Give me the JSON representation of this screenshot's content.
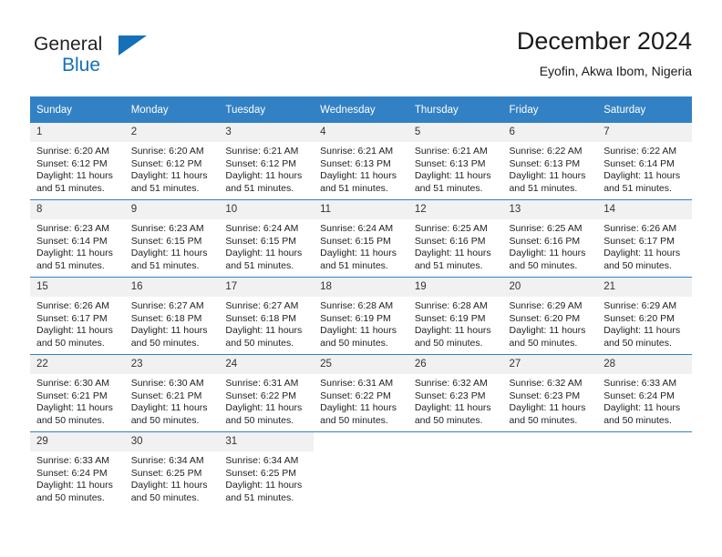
{
  "brand": {
    "name_part1": "General",
    "name_part2": "Blue",
    "accent_color": "#1470b8",
    "flag_icon": "blue-triangle-flag-icon"
  },
  "header": {
    "title": "December 2024",
    "subtitle": "Eyofin, Akwa Ibom, Nigeria"
  },
  "calendar": {
    "header_bg": "#3281c4",
    "daynum_bg": "#f1f1f1",
    "weekdays": [
      "Sunday",
      "Monday",
      "Tuesday",
      "Wednesday",
      "Thursday",
      "Friday",
      "Saturday"
    ],
    "weeks": [
      [
        {
          "day": "1",
          "sunrise": "Sunrise: 6:20 AM",
          "sunset": "Sunset: 6:12 PM",
          "daylight_1": "Daylight: 11 hours",
          "daylight_2": "and 51 minutes."
        },
        {
          "day": "2",
          "sunrise": "Sunrise: 6:20 AM",
          "sunset": "Sunset: 6:12 PM",
          "daylight_1": "Daylight: 11 hours",
          "daylight_2": "and 51 minutes."
        },
        {
          "day": "3",
          "sunrise": "Sunrise: 6:21 AM",
          "sunset": "Sunset: 6:12 PM",
          "daylight_1": "Daylight: 11 hours",
          "daylight_2": "and 51 minutes."
        },
        {
          "day": "4",
          "sunrise": "Sunrise: 6:21 AM",
          "sunset": "Sunset: 6:13 PM",
          "daylight_1": "Daylight: 11 hours",
          "daylight_2": "and 51 minutes."
        },
        {
          "day": "5",
          "sunrise": "Sunrise: 6:21 AM",
          "sunset": "Sunset: 6:13 PM",
          "daylight_1": "Daylight: 11 hours",
          "daylight_2": "and 51 minutes."
        },
        {
          "day": "6",
          "sunrise": "Sunrise: 6:22 AM",
          "sunset": "Sunset: 6:13 PM",
          "daylight_1": "Daylight: 11 hours",
          "daylight_2": "and 51 minutes."
        },
        {
          "day": "7",
          "sunrise": "Sunrise: 6:22 AM",
          "sunset": "Sunset: 6:14 PM",
          "daylight_1": "Daylight: 11 hours",
          "daylight_2": "and 51 minutes."
        }
      ],
      [
        {
          "day": "8",
          "sunrise": "Sunrise: 6:23 AM",
          "sunset": "Sunset: 6:14 PM",
          "daylight_1": "Daylight: 11 hours",
          "daylight_2": "and 51 minutes."
        },
        {
          "day": "9",
          "sunrise": "Sunrise: 6:23 AM",
          "sunset": "Sunset: 6:15 PM",
          "daylight_1": "Daylight: 11 hours",
          "daylight_2": "and 51 minutes."
        },
        {
          "day": "10",
          "sunrise": "Sunrise: 6:24 AM",
          "sunset": "Sunset: 6:15 PM",
          "daylight_1": "Daylight: 11 hours",
          "daylight_2": "and 51 minutes."
        },
        {
          "day": "11",
          "sunrise": "Sunrise: 6:24 AM",
          "sunset": "Sunset: 6:15 PM",
          "daylight_1": "Daylight: 11 hours",
          "daylight_2": "and 51 minutes."
        },
        {
          "day": "12",
          "sunrise": "Sunrise: 6:25 AM",
          "sunset": "Sunset: 6:16 PM",
          "daylight_1": "Daylight: 11 hours",
          "daylight_2": "and 51 minutes."
        },
        {
          "day": "13",
          "sunrise": "Sunrise: 6:25 AM",
          "sunset": "Sunset: 6:16 PM",
          "daylight_1": "Daylight: 11 hours",
          "daylight_2": "and 50 minutes."
        },
        {
          "day": "14",
          "sunrise": "Sunrise: 6:26 AM",
          "sunset": "Sunset: 6:17 PM",
          "daylight_1": "Daylight: 11 hours",
          "daylight_2": "and 50 minutes."
        }
      ],
      [
        {
          "day": "15",
          "sunrise": "Sunrise: 6:26 AM",
          "sunset": "Sunset: 6:17 PM",
          "daylight_1": "Daylight: 11 hours",
          "daylight_2": "and 50 minutes."
        },
        {
          "day": "16",
          "sunrise": "Sunrise: 6:27 AM",
          "sunset": "Sunset: 6:18 PM",
          "daylight_1": "Daylight: 11 hours",
          "daylight_2": "and 50 minutes."
        },
        {
          "day": "17",
          "sunrise": "Sunrise: 6:27 AM",
          "sunset": "Sunset: 6:18 PM",
          "daylight_1": "Daylight: 11 hours",
          "daylight_2": "and 50 minutes."
        },
        {
          "day": "18",
          "sunrise": "Sunrise: 6:28 AM",
          "sunset": "Sunset: 6:19 PM",
          "daylight_1": "Daylight: 11 hours",
          "daylight_2": "and 50 minutes."
        },
        {
          "day": "19",
          "sunrise": "Sunrise: 6:28 AM",
          "sunset": "Sunset: 6:19 PM",
          "daylight_1": "Daylight: 11 hours",
          "daylight_2": "and 50 minutes."
        },
        {
          "day": "20",
          "sunrise": "Sunrise: 6:29 AM",
          "sunset": "Sunset: 6:20 PM",
          "daylight_1": "Daylight: 11 hours",
          "daylight_2": "and 50 minutes."
        },
        {
          "day": "21",
          "sunrise": "Sunrise: 6:29 AM",
          "sunset": "Sunset: 6:20 PM",
          "daylight_1": "Daylight: 11 hours",
          "daylight_2": "and 50 minutes."
        }
      ],
      [
        {
          "day": "22",
          "sunrise": "Sunrise: 6:30 AM",
          "sunset": "Sunset: 6:21 PM",
          "daylight_1": "Daylight: 11 hours",
          "daylight_2": "and 50 minutes."
        },
        {
          "day": "23",
          "sunrise": "Sunrise: 6:30 AM",
          "sunset": "Sunset: 6:21 PM",
          "daylight_1": "Daylight: 11 hours",
          "daylight_2": "and 50 minutes."
        },
        {
          "day": "24",
          "sunrise": "Sunrise: 6:31 AM",
          "sunset": "Sunset: 6:22 PM",
          "daylight_1": "Daylight: 11 hours",
          "daylight_2": "and 50 minutes."
        },
        {
          "day": "25",
          "sunrise": "Sunrise: 6:31 AM",
          "sunset": "Sunset: 6:22 PM",
          "daylight_1": "Daylight: 11 hours",
          "daylight_2": "and 50 minutes."
        },
        {
          "day": "26",
          "sunrise": "Sunrise: 6:32 AM",
          "sunset": "Sunset: 6:23 PM",
          "daylight_1": "Daylight: 11 hours",
          "daylight_2": "and 50 minutes."
        },
        {
          "day": "27",
          "sunrise": "Sunrise: 6:32 AM",
          "sunset": "Sunset: 6:23 PM",
          "daylight_1": "Daylight: 11 hours",
          "daylight_2": "and 50 minutes."
        },
        {
          "day": "28",
          "sunrise": "Sunrise: 6:33 AM",
          "sunset": "Sunset: 6:24 PM",
          "daylight_1": "Daylight: 11 hours",
          "daylight_2": "and 50 minutes."
        }
      ],
      [
        {
          "day": "29",
          "sunrise": "Sunrise: 6:33 AM",
          "sunset": "Sunset: 6:24 PM",
          "daylight_1": "Daylight: 11 hours",
          "daylight_2": "and 50 minutes."
        },
        {
          "day": "30",
          "sunrise": "Sunrise: 6:34 AM",
          "sunset": "Sunset: 6:25 PM",
          "daylight_1": "Daylight: 11 hours",
          "daylight_2": "and 50 minutes."
        },
        {
          "day": "31",
          "sunrise": "Sunrise: 6:34 AM",
          "sunset": "Sunset: 6:25 PM",
          "daylight_1": "Daylight: 11 hours",
          "daylight_2": "and 51 minutes."
        },
        {
          "day": "",
          "sunrise": "",
          "sunset": "",
          "daylight_1": "",
          "daylight_2": ""
        },
        {
          "day": "",
          "sunrise": "",
          "sunset": "",
          "daylight_1": "",
          "daylight_2": ""
        },
        {
          "day": "",
          "sunrise": "",
          "sunset": "",
          "daylight_1": "",
          "daylight_2": ""
        },
        {
          "day": "",
          "sunrise": "",
          "sunset": "",
          "daylight_1": "",
          "daylight_2": ""
        }
      ]
    ]
  }
}
